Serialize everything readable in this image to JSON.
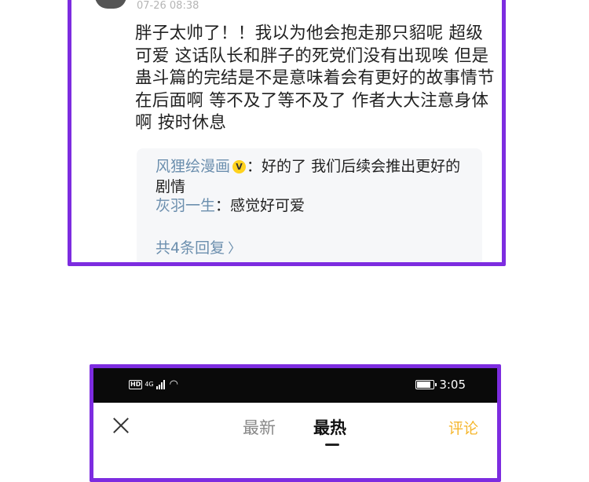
{
  "comment": {
    "timestamp": "07-26 08:38",
    "body": "胖子太帅了！！我以为他会抱走那只貂呢 超级可爱 这话队长和胖子的死党们没有出现唉 但是 蛊斗篇的完结是不是意味着会有更好的故事情节在后面啊 等不及了等不及了 作者大大注意身体啊 按时休息",
    "replies": [
      {
        "author": "风狸绘漫画",
        "verified": true,
        "verified_badge": "V",
        "text": "好的了 我们后续会推出更好的剧情"
      },
      {
        "author": "灰羽一生",
        "verified": false,
        "text": "感觉好可爱"
      }
    ],
    "more_replies": "共4条回复",
    "colon": "："
  },
  "phone": {
    "status": {
      "hd": "HD",
      "network": "4G",
      "time": "3:05"
    },
    "nav": {
      "tabs": [
        "最新",
        "最热"
      ],
      "active_tab": "最热",
      "comment_label": "评论"
    }
  },
  "colors": {
    "frame": "#7d2ce0",
    "author": "#6c8fae",
    "accent": "#f5b62c"
  }
}
